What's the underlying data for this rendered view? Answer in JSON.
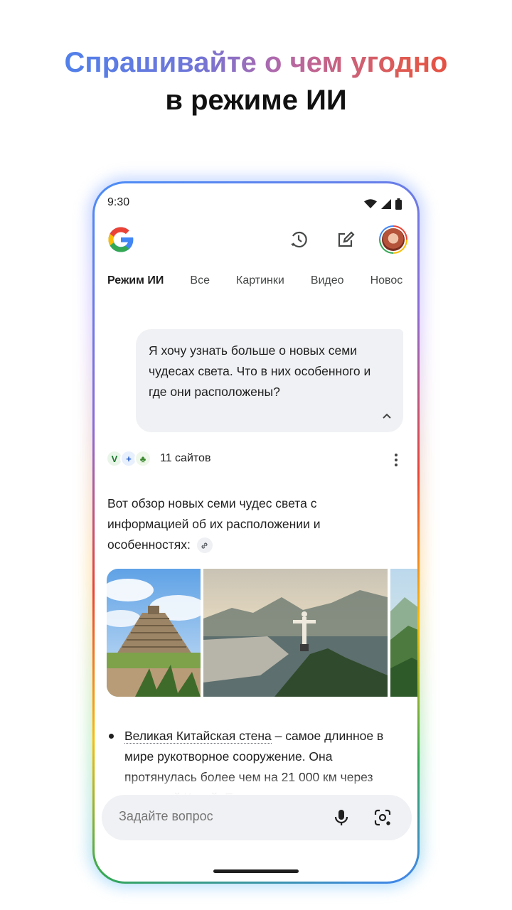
{
  "headline": {
    "line1": "Спрашивайте о чем угодно",
    "line2": "в режиме ИИ"
  },
  "status_bar": {
    "time": "9:30",
    "icons": [
      "wifi-icon",
      "signal-icon",
      "battery-icon"
    ]
  },
  "top_bar": {
    "logo": "google-g-logo",
    "icons": [
      "history-icon",
      "new-chat-icon",
      "avatar"
    ]
  },
  "tabs": [
    {
      "label": "Режим ИИ",
      "active": true
    },
    {
      "label": "Все",
      "active": false
    },
    {
      "label": "Картинки",
      "active": false
    },
    {
      "label": "Видео",
      "active": false
    },
    {
      "label": "Новос",
      "active": false
    }
  ],
  "query": {
    "text": "Я хочу узнать больше о новых семи чудесах света. Что в них особенного и где они расположены?"
  },
  "sources": {
    "count_label": "11 сайтов"
  },
  "answer": {
    "intro": "Вот обзор новых семи чудес света с информацией об их расположении и особенностях:"
  },
  "images": [
    {
      "icon": "chichen-itza-image"
    },
    {
      "icon": "christ-the-redeemer-image"
    },
    {
      "icon": "landscape-image"
    }
  ],
  "bullet": {
    "link": "Великая Китайская стена",
    "text": " – самое длинное в мире рукотворное сооружение. Она протянулась более чем на 21 000 км через северный Китай. Ее начали строить"
  },
  "ask_bar": {
    "placeholder": "Задайте вопрос"
  },
  "colors": {
    "google_blue": "#4285f4",
    "google_red": "#ea4335",
    "google_yellow": "#fbbc04",
    "google_green": "#34a853",
    "bubble_bg": "#f0f1f4"
  }
}
